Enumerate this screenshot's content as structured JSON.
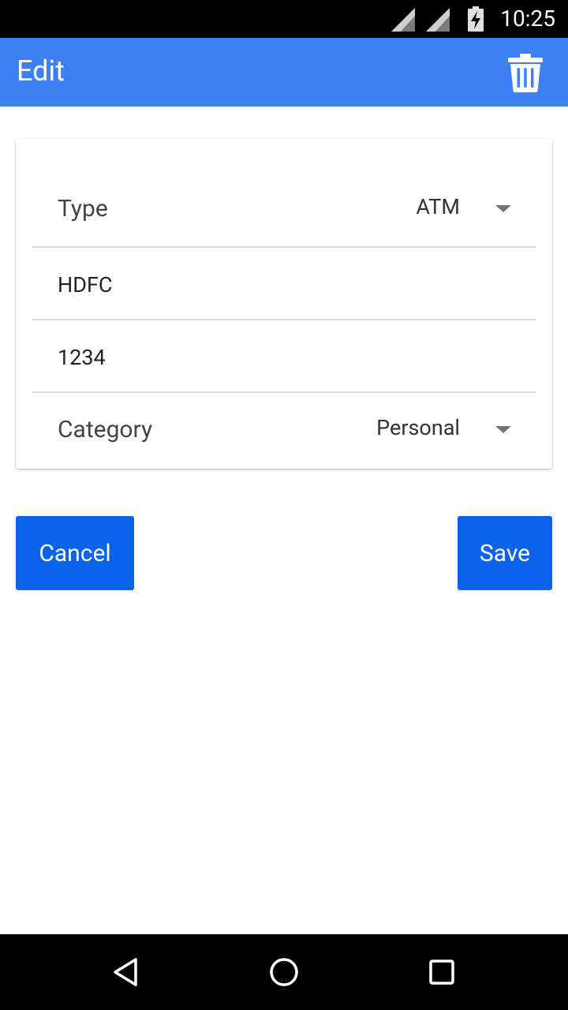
{
  "status_bar": {
    "time": "10:25",
    "icons": [
      "cell-signal-icon",
      "cell-signal-icon",
      "battery-charging-icon"
    ]
  },
  "app_bar": {
    "title": "Edit",
    "action_icon": "trash-icon"
  },
  "form": {
    "type": {
      "label": "Type",
      "value": "ATM"
    },
    "bank": {
      "value": "HDFC"
    },
    "number": {
      "value": "1234"
    },
    "category": {
      "label": "Category",
      "value": "Personal"
    }
  },
  "buttons": {
    "cancel": "Cancel",
    "save": "Save"
  },
  "nav_bar": {
    "icons": [
      "back-triangle-icon",
      "home-circle-icon",
      "recents-square-icon"
    ]
  },
  "colors": {
    "app_bar": "#3d80f4",
    "button": "#0b63ea",
    "status_bar": "#000000"
  }
}
